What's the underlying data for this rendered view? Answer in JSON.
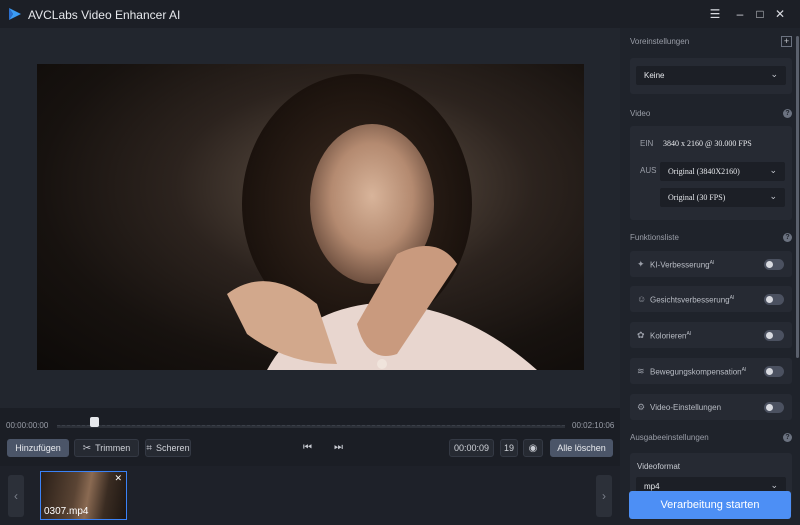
{
  "app": {
    "title": "AVCLabs Video Enhancer AI"
  },
  "window_controls": {
    "menu": "☰",
    "minimize": "–",
    "maximize": "□",
    "close": "✕"
  },
  "timeline": {
    "start_time": "00:00:00:00",
    "end_time": "00:02:10:06"
  },
  "toolbar": {
    "add_label": "Hinzufügen",
    "trim_label": "Trimmen",
    "crop_label": "Scheren",
    "timecode": "00:00:09",
    "frame": "19",
    "clear_all_label": "Alle löschen"
  },
  "thumbnails": [
    {
      "filename": "0307.mp4"
    }
  ],
  "panel": {
    "presets": {
      "label": "Voreinstellungen",
      "value": "Keine"
    },
    "video": {
      "label": "Video",
      "in_label": "EIN",
      "in_value": "3840 x 2160 @ 30.000 FPS",
      "out_label": "AUS",
      "out_resolution": "Original (3840X2160)",
      "out_fps": "Original (30 FPS)"
    },
    "features": {
      "label": "Funktionsliste",
      "items": [
        {
          "label": "KI-Verbesserung",
          "ai": "AI",
          "enabled": false
        },
        {
          "label": "Gesichtsverbesserung",
          "ai": "AI",
          "enabled": false
        },
        {
          "label": "Kolorieren",
          "ai": "AI",
          "enabled": false
        },
        {
          "label": "Bewegungskompensation",
          "ai": "AI",
          "enabled": false
        },
        {
          "label": "Video-Einstellungen",
          "ai": "",
          "enabled": false
        }
      ]
    },
    "output": {
      "label": "Ausgabeeinstellungen",
      "format_label": "Videoformat",
      "format_value": "mp4"
    },
    "start_label": "Verarbeitung starten"
  }
}
